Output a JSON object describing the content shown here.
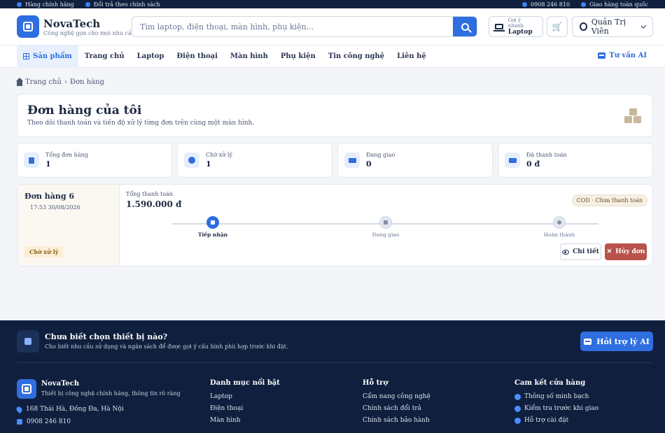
{
  "topbar": {
    "left": [
      "Hàng chính hãng",
      "Đổi trả theo chính sách"
    ],
    "right": [
      "0908 246 810",
      "Giao hàng toàn quốc"
    ]
  },
  "brand": {
    "name": "NovaTech",
    "tagline": "Công nghệ gọn cho mọi nhu cầu"
  },
  "search": {
    "placeholder": "Tìm laptop, điện thoại, màn hình, phụ kiện..."
  },
  "suggest": {
    "small": "Gợi ý nhanh",
    "big": "Laptop"
  },
  "account": {
    "name": "Quản Trị Viên"
  },
  "nav": {
    "products": "Sản phẩm",
    "items": [
      "Trang chủ",
      "Laptop",
      "Điện thoại",
      "Màn hình",
      "Phụ kiện",
      "Tin công nghệ",
      "Liên hệ"
    ],
    "ai": "Tư vấn AI"
  },
  "breadcrumb": {
    "home": "Trang chủ",
    "current": "Đơn hàng"
  },
  "hero": {
    "title": "Đơn hàng của tôi",
    "subtitle": "Theo dõi thanh toán và tiến độ xử lý từng đơn trên cùng một màn hình."
  },
  "stats": [
    {
      "label": "Tổng đơn hàng",
      "value": "1",
      "icon": "document-icon"
    },
    {
      "label": "Chờ xử lý",
      "value": "1",
      "icon": "clock-icon"
    },
    {
      "label": "Đang giao",
      "value": "0",
      "icon": "truck-icon"
    },
    {
      "label": "Đã thanh toán",
      "value": "0 đ",
      "icon": "card-icon"
    }
  ],
  "order": {
    "id": "Đơn hàng 6",
    "time": "17:53 30/08/2026",
    "status": "Chờ xử lý",
    "total_label": "Tổng thanh toán",
    "total": "1.590.000 đ",
    "payment": "COD · Chưa thanh toán",
    "steps": [
      "Tiếp nhận",
      "Đang giao",
      "Hoàn thành"
    ],
    "detail_label": "Chi tiết",
    "cancel_label": "Hủy đơn"
  },
  "footer": {
    "ai_title": "Chưa biết chọn thiết bị nào?",
    "ai_sub": "Cho biết nhu cầu sử dụng và ngân sách để được gợi ý cấu hình phù hợp trước khi đặt.",
    "ai_button": "Hỏi trợ lý AI",
    "brand": "NovaTech",
    "tagline": "Thiết bị công nghệ chính hãng, thông tin rõ ràng",
    "address": "168 Thái Hà, Đống Đa, Hà Nội",
    "phone": "0908 246 810",
    "col1": {
      "title": "Danh mục nổi bật",
      "items": [
        "Laptop",
        "Điện thoại",
        "Màn hình"
      ]
    },
    "col2": {
      "title": "Hỗ trợ",
      "items": [
        "Cẩm nang công nghệ",
        "Chính sách đổi trả",
        "Chính sách bảo hành"
      ]
    },
    "col3": {
      "title": "Cam kết cửa hàng",
      "items": [
        "Thông số minh bạch",
        "Kiểm tra trước khi giao",
        "Hỗ trợ cài đặt"
      ]
    }
  },
  "colors": {
    "accent": "#2f6ee0",
    "danger": "#b9524b",
    "footer": "#0f1f3d"
  }
}
